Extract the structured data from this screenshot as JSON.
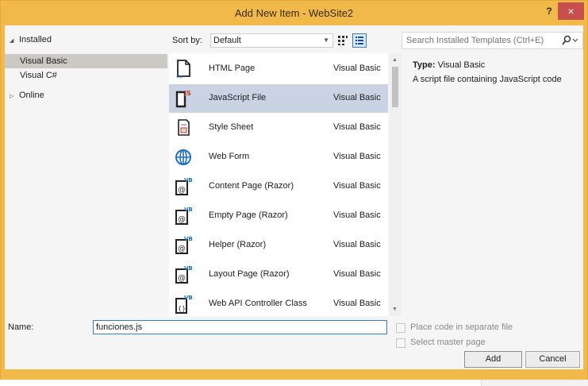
{
  "window": {
    "title": "Add New Item - WebSite2",
    "help_label": "?",
    "close_label": "×"
  },
  "tree": {
    "installed_label": "Installed",
    "items": [
      {
        "label": "Visual Basic",
        "selected": true
      },
      {
        "label": "Visual C#",
        "selected": false
      }
    ],
    "online_label": "Online"
  },
  "sort": {
    "label": "Sort by:",
    "value": "Default"
  },
  "templates": [
    {
      "name": "HTML Page",
      "language": "Visual Basic",
      "icon": "html-page-icon",
      "selected": false
    },
    {
      "name": "JavaScript File",
      "language": "Visual Basic",
      "icon": "javascript-file-icon",
      "selected": true
    },
    {
      "name": "Style Sheet",
      "language": "Visual Basic",
      "icon": "style-sheet-icon",
      "selected": false
    },
    {
      "name": "Web Form",
      "language": "Visual Basic",
      "icon": "web-form-globe-icon",
      "selected": false
    },
    {
      "name": "Content Page (Razor)",
      "language": "Visual Basic",
      "icon": "vb-razor-page-icon",
      "selected": false
    },
    {
      "name": "Empty Page (Razor)",
      "language": "Visual Basic",
      "icon": "vb-razor-page-icon",
      "selected": false
    },
    {
      "name": "Helper (Razor)",
      "language": "Visual Basic",
      "icon": "vb-razor-page-icon",
      "selected": false
    },
    {
      "name": "Layout Page (Razor)",
      "language": "Visual Basic",
      "icon": "vb-razor-page-icon",
      "selected": false
    },
    {
      "name": "Web API Controller Class",
      "language": "Visual Basic",
      "icon": "vb-class-icon",
      "selected": false
    }
  ],
  "search": {
    "placeholder": "Search Installed Templates (Ctrl+E)"
  },
  "details": {
    "type_label": "Type:",
    "type_value": "Visual Basic",
    "description": "A script file containing JavaScript code"
  },
  "form": {
    "name_label": "Name:",
    "name_value": "funciones.js",
    "place_code_label": "Place code in separate file",
    "master_page_label": "Select master page",
    "add_label": "Add",
    "cancel_label": "Cancel"
  },
  "colors": {
    "accent": "#f0b94a",
    "selection": "#c9d3e4",
    "close": "#c7504f"
  }
}
